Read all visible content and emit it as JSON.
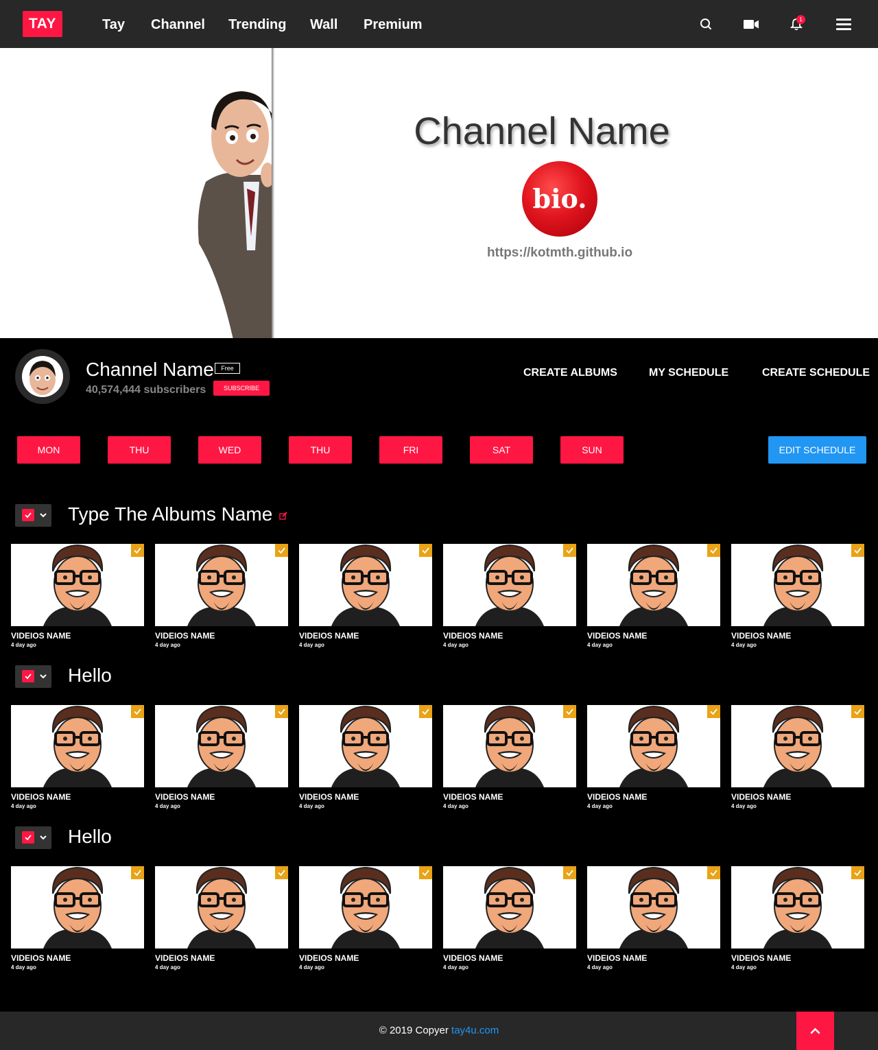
{
  "nav": {
    "logo": "TAY",
    "links": [
      "Tay",
      "Channel",
      "Trending",
      "Wall",
      "Premium"
    ],
    "icons": [
      "search-icon",
      "video-camera-icon",
      "bell-icon",
      "menu-icon"
    ],
    "notification_count": "1"
  },
  "banner": {
    "title": "Channel Name",
    "bio_logo": "bio.",
    "url": "https://kotmth.github.io"
  },
  "channel": {
    "name": "Channel Name",
    "badge": "Free",
    "subscribers": "40,574,444 subscribers",
    "subscribe_label": "SUBSCRIBE",
    "actions": [
      "CREATE ALBUMS",
      "MY SCHEDULE",
      "CREATE SCHEDULE"
    ]
  },
  "schedule": {
    "days": [
      "MON",
      "THU",
      "WED",
      "THU",
      "FRI",
      "SAT",
      "SUN"
    ],
    "edit_label": "EDIT SCHEDULE"
  },
  "albums": [
    {
      "title": "Type The Albums Name",
      "editable": true,
      "videos": [
        {
          "title": "VIDEIOS NAME",
          "meta": "4 day ago"
        },
        {
          "title": "VIDEIOS NAME",
          "meta": "4 day ago"
        },
        {
          "title": "VIDEIOS NAME",
          "meta": "4 day ago"
        },
        {
          "title": "VIDEIOS NAME",
          "meta": "4 day ago"
        },
        {
          "title": "VIDEIOS NAME",
          "meta": "4 day ago"
        },
        {
          "title": "VIDEIOS NAME",
          "meta": "4 day ago"
        }
      ]
    },
    {
      "title": "Hello",
      "editable": false,
      "videos": [
        {
          "title": "VIDEIOS NAME",
          "meta": "4 day ago"
        },
        {
          "title": "VIDEIOS NAME",
          "meta": "4 day ago"
        },
        {
          "title": "VIDEIOS NAME",
          "meta": "4 day ago"
        },
        {
          "title": "VIDEIOS NAME",
          "meta": "4 day ago"
        },
        {
          "title": "VIDEIOS NAME",
          "meta": "4 day ago"
        },
        {
          "title": "VIDEIOS NAME",
          "meta": "4 day ago"
        }
      ]
    },
    {
      "title": "Hello",
      "editable": false,
      "videos": [
        {
          "title": "VIDEIOS NAME",
          "meta": "4 day ago"
        },
        {
          "title": "VIDEIOS NAME",
          "meta": "4 day ago"
        },
        {
          "title": "VIDEIOS NAME",
          "meta": "4 day ago"
        },
        {
          "title": "VIDEIOS NAME",
          "meta": "4 day ago"
        },
        {
          "title": "VIDEIOS NAME",
          "meta": "4 day ago"
        },
        {
          "title": "VIDEIOS NAME",
          "meta": "4 day ago"
        }
      ]
    }
  ],
  "footer": {
    "text": "© 2019 Copyer ",
    "link": "tay4u.com"
  },
  "colors": {
    "accent": "#ff1744",
    "primary_blue": "#2196f3",
    "navbar_bg": "#282828",
    "page_bg": "#000000",
    "check_badge": "#e8a317"
  }
}
